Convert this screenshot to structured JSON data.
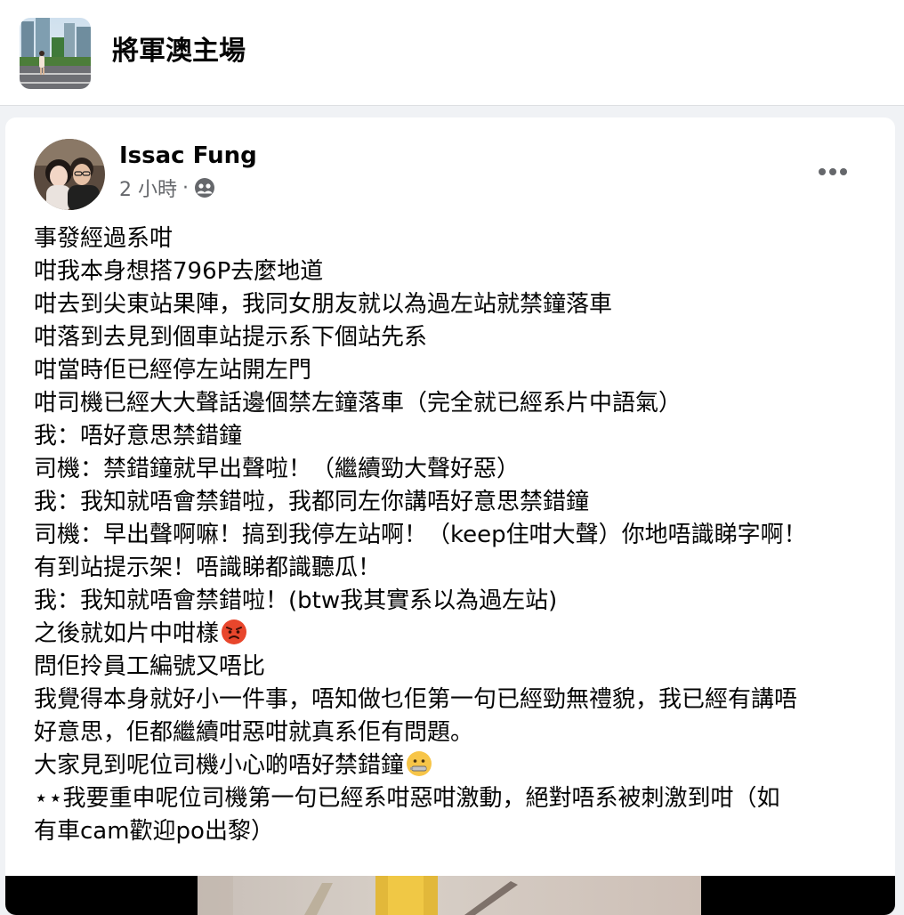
{
  "group": {
    "name": "將軍澳主場",
    "avatar_icon": "group-photo-icon"
  },
  "post": {
    "author": "Issac Fung",
    "time": "2 小時",
    "separator": "·",
    "privacy_icon": "friends-icon",
    "more_icon": "more-dots-icon",
    "lines": [
      "事發經過系咁",
      "咁我本身想搭796P去麼地道",
      "咁去到尖東站果陣，我同女朋友就以為過左站就禁鐘落車",
      "咁落到去見到個車站提示系下個站先系",
      "咁當時佢已經停左站開左門",
      "咁司機已經大大聲話邊個禁左鐘落車（完全就已經系片中語氣）",
      "我：唔好意思禁錯鐘",
      "司機：禁錯鐘就早出聲啦！（繼續勁大聲好惡）",
      "我：我知就唔會禁錯啦，我都同左你講唔好意思禁錯鐘",
      "司機：早出聲啊嘛！搞到我停左站啊！（keep住咁大聲）你地唔識睇字啊！",
      "有到站提示架！唔識睇都識聽瓜！",
      "我：我知就唔會禁錯啦！(btw我其實系以為過左站)",
      "之後就如片中咁樣",
      "問佢拎員工編號又唔比",
      "我覺得本身就好小一件事，唔知做乜佢第一句已經勁無禮貌，我已經有講唔",
      "好意思，佢都繼續咁惡咁就真系佢有問題。",
      "大家見到呢位司機小心啲唔好禁錯鐘",
      "⋆⋆我要重申呢位司機第一句已經系咁惡咁激動，絕對唔系被刺激到咁（如",
      "有車cam歡迎po出黎）"
    ],
    "emojis": {
      "angry": "angry-face-icon",
      "zipper": "zipper-mouth-face-icon"
    },
    "colors": {
      "text": "#050505",
      "secondary": "#65676b",
      "angry_face": "#e8462c"
    }
  }
}
